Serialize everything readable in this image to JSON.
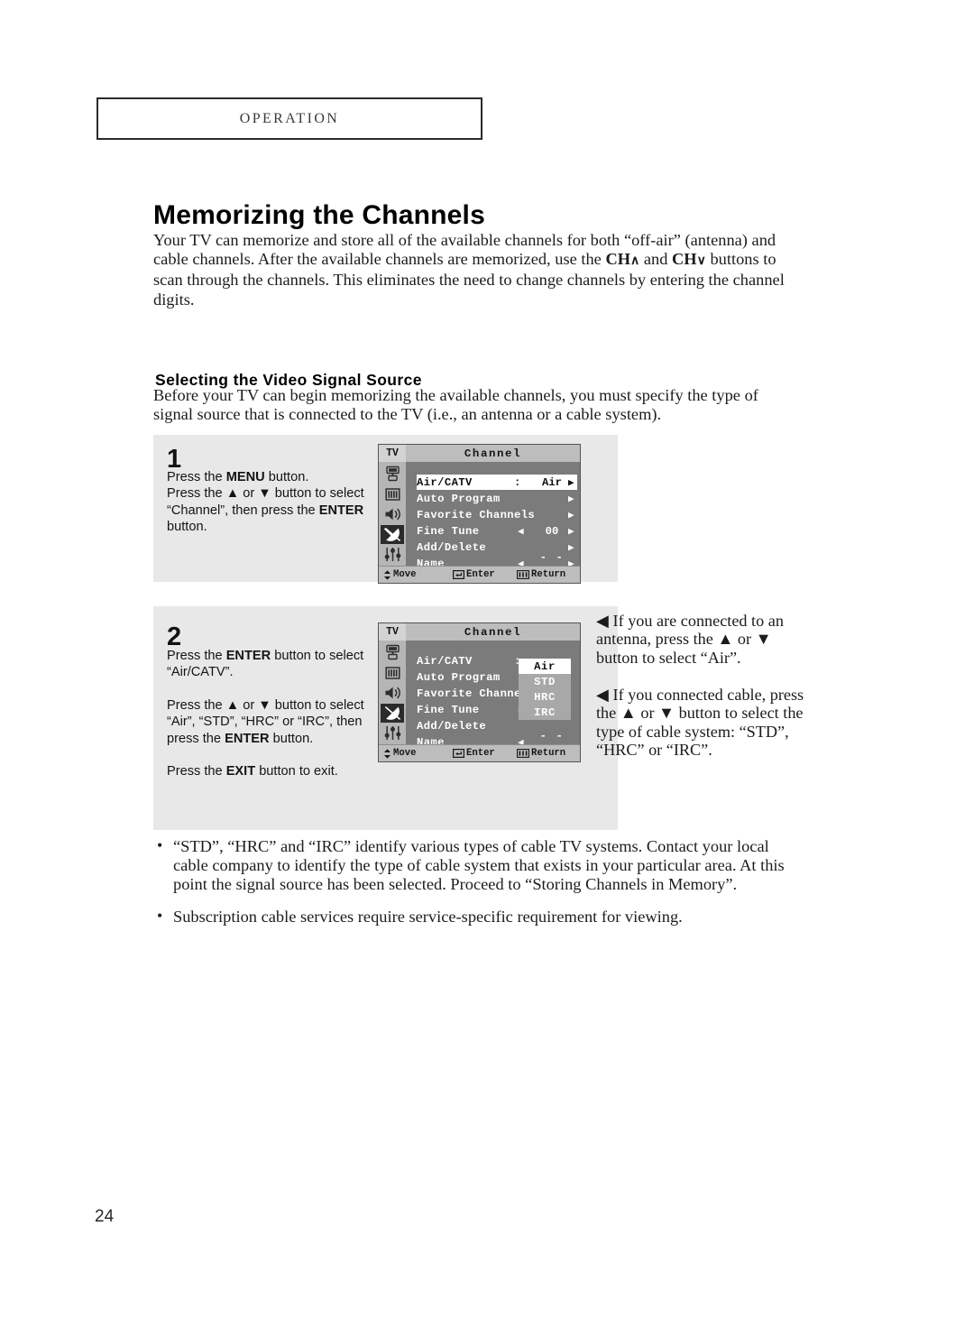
{
  "header": {
    "chapter_label": "OPERATION"
  },
  "page": {
    "title": "Memorizing the Channels",
    "subtitle": "Selecting the Video Signal Source",
    "folio": "24"
  },
  "intro_paragraph": {
    "line1": "Your TV can memorize and store all of the available channels for both “off-air” (antenna) and",
    "line2a": "cable channels. After the available channels are memorized, use the ",
    "ch_up": "CH",
    "ch_up_arrow": "∧",
    "and": " and ",
    "ch_down": "CH",
    "ch_down_arrow": "∨",
    "line2b": " buttons",
    "line3": "to scan through the channels. This eliminates the need to change channels by entering the",
    "line4": "channel digits."
  },
  "sub_paragraph": {
    "text": "Before your TV can begin memorizing the available channels, you must specify the type of signal source that is connected to the TV (i.e., an antenna or a cable system)."
  },
  "steps": [
    {
      "number": "1",
      "lines": [
        {
          "parts": [
            "Press the ",
            "MENU",
            " button."
          ]
        },
        {
          "parts": [
            "Press the ",
            "▲",
            " or ",
            "▼",
            " button to select"
          ]
        },
        {
          "parts": [
            "“Channel”, then press the ",
            "ENTER"
          ]
        },
        {
          "parts": [
            "button."
          ]
        }
      ]
    },
    {
      "number": "2",
      "lines": [
        {
          "parts": [
            "Press the ",
            "ENTER",
            " button to select"
          ]
        },
        {
          "parts": [
            "“Air/CATV”."
          ]
        },
        {
          "parts": [
            "Press the ",
            "▲",
            " or ",
            "▼",
            " button to select"
          ]
        },
        {
          "parts": [
            "“Air”, “STD”, “HRC” or “IRC”,  then"
          ]
        },
        {
          "parts": [
            "press the ",
            "ENTER",
            " button."
          ]
        },
        {
          "parts": [
            "Press the ",
            "EXIT",
            " button to exit."
          ]
        }
      ]
    }
  ],
  "step1_text": {
    "l1_pre": "Press the ",
    "l1_bold": "MENU",
    "l1_post": " button.",
    "l2_pre": "Press the ",
    "l2_up": "▲",
    "l2_mid": " or ",
    "l2_down": "▼",
    "l2_post": " button to select",
    "l3_pre": "“Channel”, then press the ",
    "l3_bold": "ENTER",
    "l4": "button."
  },
  "step2_text": {
    "p1_pre": "Press the ",
    "p1_bold": "ENTER",
    "p1_post": " button to select",
    "p1_l2": "“Air/CATV”.",
    "p2_pre": "Press the ",
    "p2_up": "▲",
    "p2_mid": " or ",
    "p2_down": "▼",
    "p2_post": " button to select",
    "p2_l2": "“Air”, “STD”, “HRC” or “IRC”,  then",
    "p2_l3_pre": "press the ",
    "p2_l3_bold": "ENTER",
    "p2_l3_post": " button.",
    "p3_pre": "Press the ",
    "p3_bold": "EXIT",
    "p3_post": " button to exit."
  },
  "callouts": {
    "one": {
      "marker": "◀",
      "l1": " If you are connected to an",
      "l2_pre": "antenna, press the ",
      "l2_up": "▲",
      "l2_mid": " or ",
      "l2_down": "▼",
      "l3": "button to select “Air”."
    },
    "two": {
      "marker": "◀",
      "l1": " If you connected cable, press",
      "l2_pre": "the ",
      "l2_up": "▲",
      "l2_mid": " or ",
      "l2_down": "▼",
      "l2_post": " button to select the",
      "l3": "type of cable system: “STD”,",
      "l4": "“HRC” or “IRC”."
    }
  },
  "osd": {
    "tv_label": "TV",
    "title": "Channel",
    "rail_icons": [
      "input-source-icon",
      "picture-icon",
      "sound-icon",
      "channel-dish-icon",
      "setup-sliders-icon"
    ],
    "rail_active_index": 3,
    "rows": [
      {
        "label": "Air/CATV",
        "colon": ":",
        "value": "Air",
        "left_arrow": "",
        "right_arrow": "▶",
        "selected": true
      },
      {
        "label": "Auto Program",
        "colon": "",
        "value": "",
        "left_arrow": "",
        "right_arrow": "▶",
        "selected": false
      },
      {
        "label": "Favorite Channels",
        "colon": "",
        "value": "",
        "left_arrow": "",
        "right_arrow": "▶",
        "selected": false
      },
      {
        "label": "Fine Tune",
        "colon": "",
        "value": "00",
        "left_arrow": "◀",
        "right_arrow": "▶",
        "selected": false
      },
      {
        "label": "Add/Delete",
        "colon": "",
        "value": "",
        "left_arrow": "",
        "right_arrow": "▶",
        "selected": false
      },
      {
        "label": "Name",
        "colon": "",
        "value": "- - - -",
        "left_arrow": "◀",
        "right_arrow": "▶",
        "selected": false
      }
    ],
    "rows2": [
      {
        "label": "Air/CATV",
        "colon": ":",
        "value": "",
        "left_arrow": "",
        "right_arrow": ""
      },
      {
        "label": "Auto Program",
        "colon": "",
        "value": "",
        "left_arrow": "",
        "right_arrow": ""
      },
      {
        "label": "Favorite Channe",
        "colon": "",
        "value": "",
        "left_arrow": "",
        "right_arrow": ""
      },
      {
        "label": "Fine Tune",
        "colon": "",
        "value": "",
        "left_arrow": "◀",
        "right_arrow": ""
      },
      {
        "label": "Add/Delete",
        "colon": "",
        "value": "",
        "left_arrow": "",
        "right_arrow": ""
      },
      {
        "label": "Name",
        "colon": "",
        "value": "- - - -",
        "left_arrow": "◀",
        "right_arrow": ""
      }
    ],
    "dropdown": {
      "options": [
        "Air",
        "STD",
        "HRC",
        "IRC"
      ],
      "selected": "Air"
    },
    "footer": {
      "move": "Move",
      "enter": "Enter",
      "return": "Return"
    }
  },
  "bullets": [
    "“STD”, “HRC” and “IRC” identify various types of cable TV systems. Contact your local cable company to identify the type of cable system that exists in your particular area. At this point the signal source has been selected. Proceed to “Storing Channels in Memory”.",
    "Subscription cable services require service-specific requirement for viewing."
  ],
  "colors": {
    "page_bg": "#ffffff",
    "step_block_bg": "#e8e8e8",
    "osd_body": "#7b7b7b",
    "osd_bar": "#bdbdbd",
    "osd_rail": "#b5b5b5",
    "osd_active_icon": "#2b2b2b",
    "osd_dropdown_bg": "#a8a8a8",
    "text": "#1c1c1c"
  }
}
